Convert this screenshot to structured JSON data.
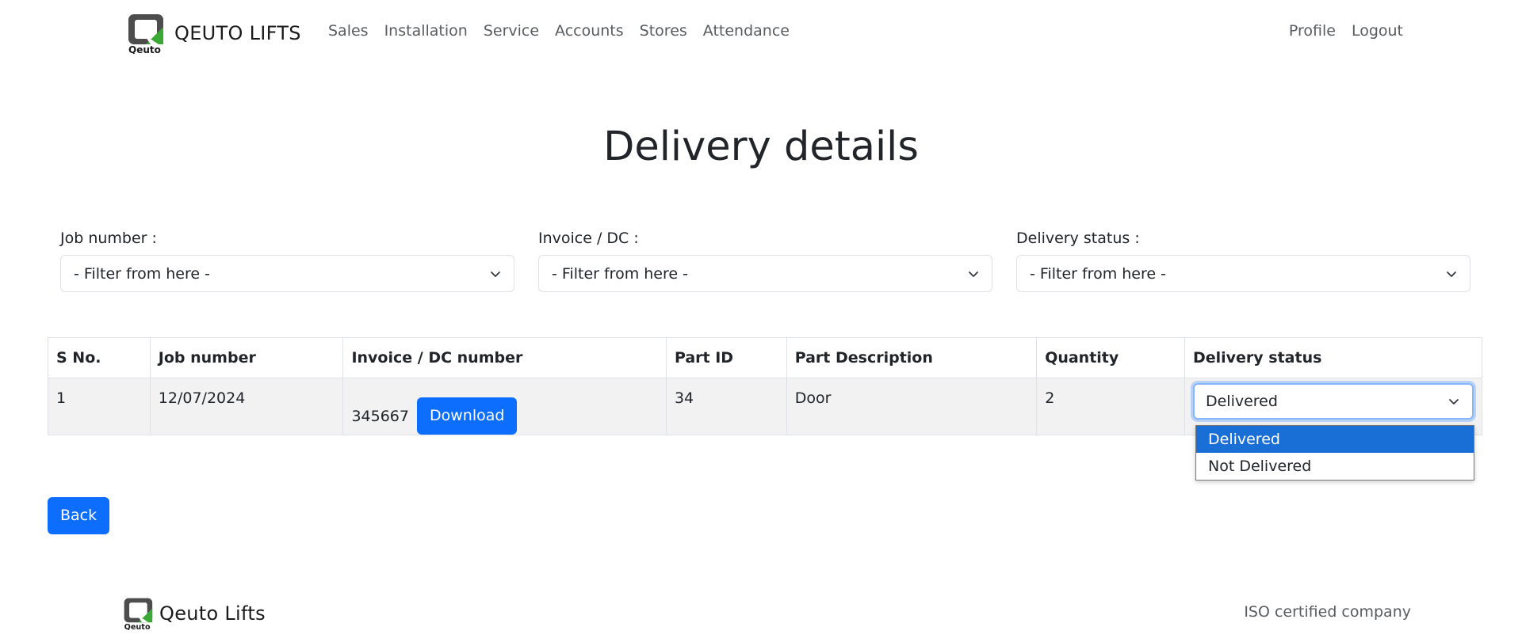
{
  "navbar": {
    "logo_text": "Qeuto",
    "brand": "QEUTO LIFTS",
    "links": [
      "Sales",
      "Installation",
      "Service",
      "Accounts",
      "Stores",
      "Attendance"
    ],
    "right_links": [
      "Profile",
      "Logout"
    ]
  },
  "page": {
    "title": "Delivery details"
  },
  "filters": [
    {
      "label": "Job number :",
      "value": "- Filter from here -"
    },
    {
      "label": "Invoice / DC :",
      "value": "- Filter from here -"
    },
    {
      "label": "Delivery status :",
      "value": "- Filter from here -"
    }
  ],
  "table": {
    "headers": [
      "S No.",
      "Job number",
      "Invoice / DC number",
      "Part ID",
      "Part Description",
      "Quantity",
      "Delivery status"
    ],
    "rows": [
      {
        "sno": "1",
        "job_number": "12/07/2024",
        "invoice": "345667",
        "download_label": "Download",
        "part_id": "34",
        "part_description": "Door",
        "quantity": "2",
        "delivery_status": "Delivered"
      }
    ]
  },
  "status_dropdown": {
    "options": [
      "Delivered",
      "Not Delivered"
    ],
    "selected": "Delivered"
  },
  "back_label": "Back",
  "footer": {
    "logo_text": "Qeuto",
    "brand": "Qeuto Lifts",
    "tagline": "ISO certified company"
  },
  "colors": {
    "primary": "#0d6efd",
    "logo_grey": "#4d4d4d",
    "logo_green": "#3aa935",
    "option_highlight": "#1a6fd6"
  }
}
